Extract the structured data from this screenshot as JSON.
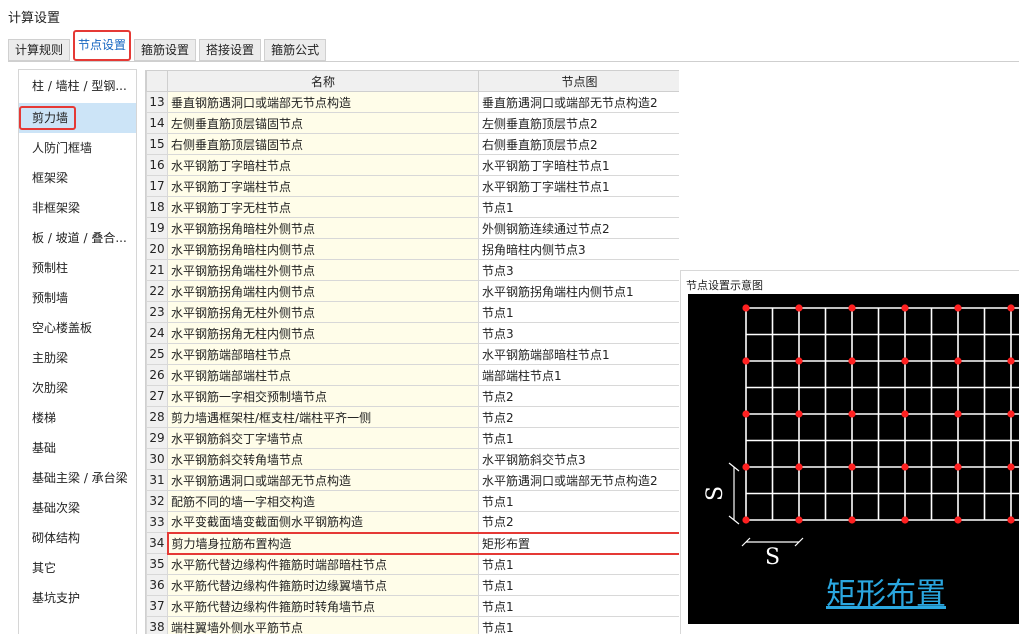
{
  "window": {
    "title": "计算设置"
  },
  "tabs": [
    {
      "label": "计算规则",
      "active": false
    },
    {
      "label": "节点设置",
      "active": true
    },
    {
      "label": "箍筋设置",
      "active": false
    },
    {
      "label": "搭接设置",
      "active": false
    },
    {
      "label": "箍筋公式",
      "active": false
    }
  ],
  "sidebar": {
    "items": [
      {
        "label": "柱 / 墙柱 / 型钢..."
      },
      {
        "label": "剪力墙",
        "selected": true
      },
      {
        "label": "人防门框墙"
      },
      {
        "label": "框架梁"
      },
      {
        "label": "非框架梁"
      },
      {
        "label": "板 / 坡道 / 叠合..."
      },
      {
        "label": "预制柱"
      },
      {
        "label": "预制墙"
      },
      {
        "label": "空心楼盖板"
      },
      {
        "label": "主肋梁"
      },
      {
        "label": "次肋梁"
      },
      {
        "label": "楼梯"
      },
      {
        "label": "基础"
      },
      {
        "label": "基础主梁 / 承台梁"
      },
      {
        "label": "基础次梁"
      },
      {
        "label": "砌体结构"
      },
      {
        "label": "其它"
      },
      {
        "label": "基坑支护"
      }
    ]
  },
  "table": {
    "headers": {
      "num": "",
      "name": "名称",
      "node": "节点图"
    },
    "rows": [
      {
        "num": "13",
        "name": "垂直钢筋遇洞口或端部无节点构造",
        "node": "垂直筋遇洞口或端部无节点构造2"
      },
      {
        "num": "14",
        "name": "左侧垂直筋顶层锚固节点",
        "node": "左侧垂直筋顶层节点2"
      },
      {
        "num": "15",
        "name": "右侧垂直筋顶层锚固节点",
        "node": "右侧垂直筋顶层节点2"
      },
      {
        "num": "16",
        "name": "水平钢筋丁字暗柱节点",
        "node": "水平钢筋丁字暗柱节点1"
      },
      {
        "num": "17",
        "name": "水平钢筋丁字端柱节点",
        "node": "水平钢筋丁字端柱节点1"
      },
      {
        "num": "18",
        "name": "水平钢筋丁字无柱节点",
        "node": "节点1"
      },
      {
        "num": "19",
        "name": "水平钢筋拐角暗柱外侧节点",
        "node": "外侧钢筋连续通过节点2"
      },
      {
        "num": "20",
        "name": "水平钢筋拐角暗柱内侧节点",
        "node": "拐角暗柱内侧节点3"
      },
      {
        "num": "21",
        "name": "水平钢筋拐角端柱外侧节点",
        "node": "节点3"
      },
      {
        "num": "22",
        "name": "水平钢筋拐角端柱内侧节点",
        "node": "水平钢筋拐角端柱内侧节点1"
      },
      {
        "num": "23",
        "name": "水平钢筋拐角无柱外侧节点",
        "node": "节点1"
      },
      {
        "num": "24",
        "name": "水平钢筋拐角无柱内侧节点",
        "node": "节点3"
      },
      {
        "num": "25",
        "name": "水平钢筋端部暗柱节点",
        "node": "水平钢筋端部暗柱节点1"
      },
      {
        "num": "26",
        "name": "水平钢筋端部端柱节点",
        "node": "端部端柱节点1"
      },
      {
        "num": "27",
        "name": "水平钢筋一字相交预制墙节点",
        "node": "节点2"
      },
      {
        "num": "28",
        "name": "剪力墙遇框架柱/框支柱/端柱平齐一侧",
        "node": "节点2"
      },
      {
        "num": "29",
        "name": "水平钢筋斜交丁字墙节点",
        "node": "节点1"
      },
      {
        "num": "30",
        "name": "水平钢筋斜交转角墙节点",
        "node": "水平钢筋斜交节点3"
      },
      {
        "num": "31",
        "name": "水平钢筋遇洞口或端部无节点构造",
        "node": "水平筋遇洞口或端部无节点构造2"
      },
      {
        "num": "32",
        "name": "配筋不同的墙一字相交构造",
        "node": "节点1"
      },
      {
        "num": "33",
        "name": "水平变截面墙变截面侧水平钢筋构造",
        "node": "节点2"
      },
      {
        "num": "34",
        "name": "剪力墙身拉筋布置构造",
        "node": "矩形布置",
        "highlighted": true
      },
      {
        "num": "35",
        "name": "水平筋代替边缘构件箍筋时端部暗柱节点",
        "node": "节点1"
      },
      {
        "num": "36",
        "name": "水平筋代替边缘构件箍筋时边缘翼墙节点",
        "node": "节点1"
      },
      {
        "num": "37",
        "name": "水平筋代替边缘构件箍筋时转角墙节点",
        "node": "节点1"
      },
      {
        "num": "38",
        "name": "端柱翼墙外侧水平筋节点",
        "node": "节点1"
      }
    ]
  },
  "preview": {
    "label": "节点设置示意图",
    "caption": "矩形布置",
    "dim_vertical": "S",
    "dim_horizontal": "S",
    "colors": {
      "background": "#000000",
      "grid": "#ffffff",
      "dot": "#ff2020",
      "caption": "#2aa7e0"
    }
  }
}
